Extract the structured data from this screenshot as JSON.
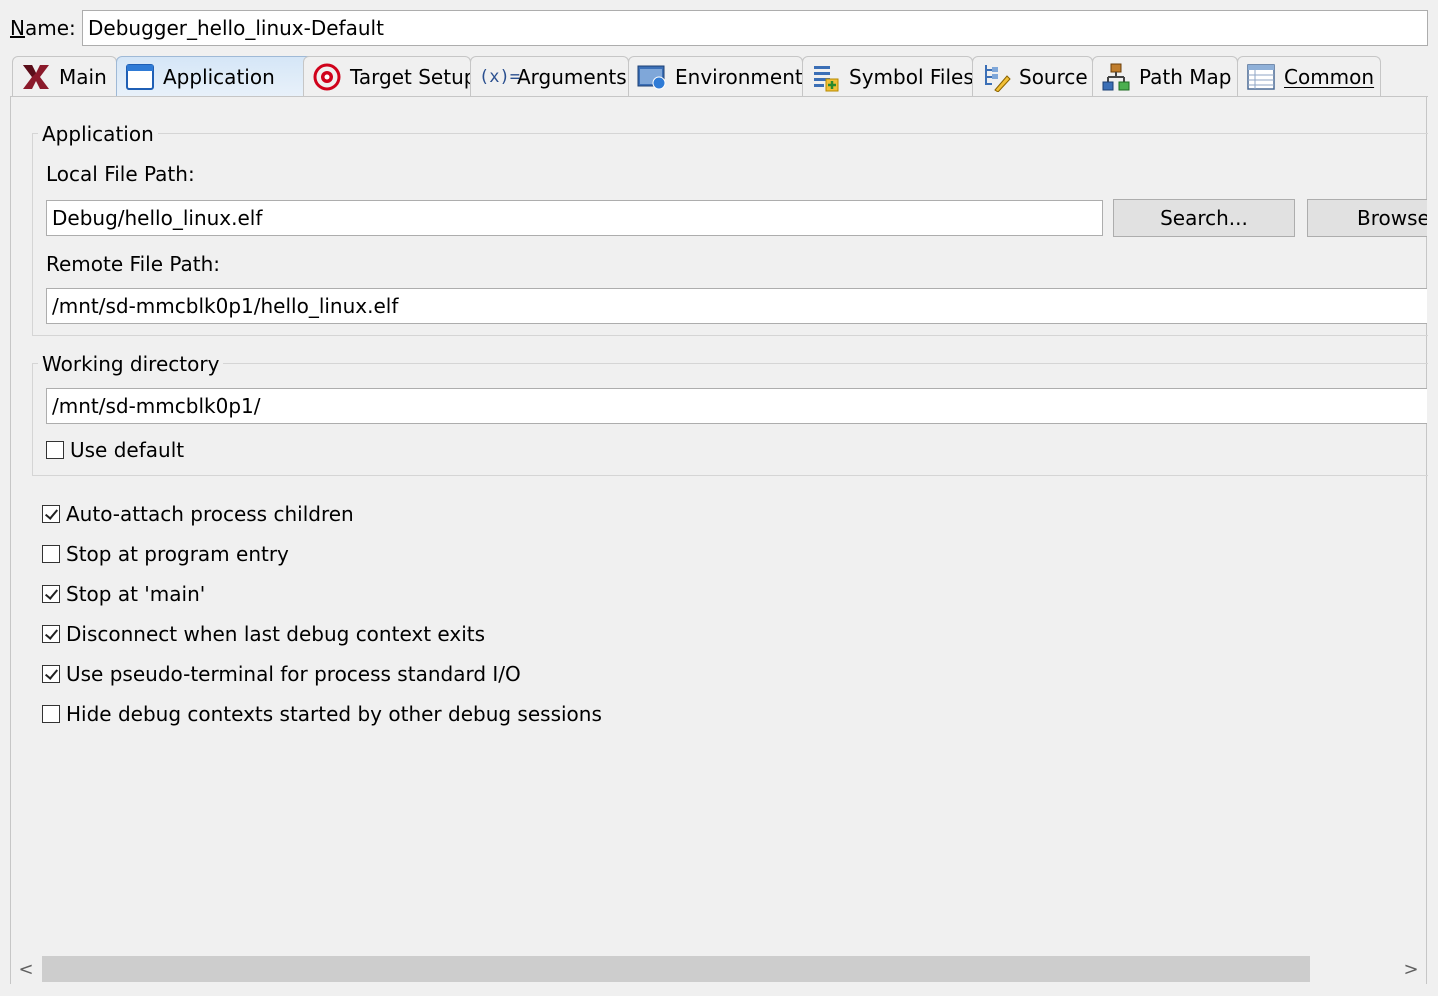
{
  "header": {
    "name_label": "Name:",
    "name_mnemonic": "N",
    "name_rest": "ame:",
    "name_value": "Debugger_hello_linux-Default"
  },
  "tabs": [
    {
      "label": "Main",
      "icon": "xilinx-logo-icon",
      "active": false
    },
    {
      "label": "Application",
      "icon": "application-window-icon",
      "active": true
    },
    {
      "label": "Target Setup",
      "icon": "target-icon",
      "active": false
    },
    {
      "label": "Arguments",
      "icon": "variable-x-icon",
      "active": false
    },
    {
      "label": "Environment",
      "icon": "environment-icon",
      "active": false
    },
    {
      "label": "Symbol Files",
      "icon": "symbol-files-icon",
      "active": false
    },
    {
      "label": "Source",
      "icon": "source-lookup-icon",
      "active": false
    },
    {
      "label": "Path Map",
      "icon": "path-map-icon",
      "active": false
    },
    {
      "label": "Common",
      "icon": "common-table-icon",
      "active": false
    }
  ],
  "application_group": {
    "title": "Application",
    "local_label": "Local File Path:",
    "local_value": "Debug/hello_linux.elf",
    "search_button": "Search...",
    "browse_button": "Browse...",
    "remote_label": "Remote File Path:",
    "remote_value": "/mnt/sd-mmcblk0p1/hello_linux.elf"
  },
  "working_directory_group": {
    "title": "Working directory",
    "value": "/mnt/sd-mmcblk0p1/",
    "use_default_label": "Use default",
    "use_default_checked": false
  },
  "options": [
    {
      "label": "Auto-attach process children",
      "checked": true
    },
    {
      "label": "Stop at program entry",
      "checked": false
    },
    {
      "label": "Stop at 'main'",
      "checked": true
    },
    {
      "label": "Disconnect when last debug context exits",
      "checked": true
    },
    {
      "label": "Use pseudo-terminal for process standard I/O",
      "checked": true
    },
    {
      "label": "Hide debug contexts started by other debug sessions",
      "checked": false
    }
  ],
  "scrollbar": {
    "left_arrow": "<",
    "right_arrow": ">"
  },
  "colors": {
    "active_tab": "#d5e6f7",
    "xilinx_red": "#8b1a2b",
    "target_red": "#d0021b"
  }
}
